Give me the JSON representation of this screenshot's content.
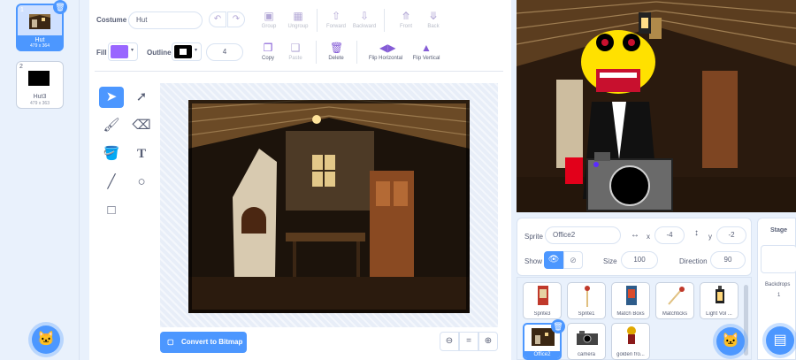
{
  "costumes": [
    {
      "number": "1",
      "name": "Hut",
      "size": "479 x 364",
      "selected": true
    },
    {
      "number": "2",
      "name": "Hut3",
      "size": "479 x 363",
      "selected": false
    }
  ],
  "editor": {
    "costume_label": "Costume",
    "costume_name": "Hut",
    "fill_label": "Fill",
    "fill_color": "#9966ff",
    "outline_label": "Outline",
    "outline_color": "#000000",
    "outline_width": "4",
    "group_label": "Group",
    "ungroup_label": "Ungroup",
    "forward_label": "Forward",
    "backward_label": "Backward",
    "front_label": "Front",
    "back_label": "Back",
    "copy_label": "Copy",
    "paste_label": "Paste",
    "delete_label": "Delete",
    "flip_h_label": "Flip Horizontal",
    "flip_v_label": "Flip Vertical",
    "convert_label": "Convert to Bitmap",
    "zoom_reset_label": "="
  },
  "sprite": {
    "sprite_label": "Sprite",
    "name": "Office2",
    "x_label": "x",
    "x": "-4",
    "y_label": "y",
    "y": "-2",
    "show_label": "Show",
    "size_label": "Size",
    "size": "100",
    "direction_label": "Direction",
    "direction": "90"
  },
  "sprites": [
    {
      "name": "Sprite3",
      "icon": "match-box-icon"
    },
    {
      "name": "Sprite1",
      "icon": "match-stick-icon"
    },
    {
      "name": "Match Boxs",
      "icon": "match-box-icon"
    },
    {
      "name": "Matchticks",
      "icon": "match-stick-icon"
    },
    {
      "name": "Light Vol ...",
      "icon": "lantern-icon"
    },
    {
      "name": "Office2",
      "icon": "office-thumb-icon",
      "selected": true
    },
    {
      "name": "camera",
      "icon": "camera-icon"
    },
    {
      "name": "golden fro...",
      "icon": "frog-icon"
    }
  ],
  "stage_panel": {
    "title": "Stage",
    "backdrops_label": "Backdrops",
    "backdrops_count": "1"
  },
  "colors": {
    "accent": "#4c97ff",
    "paint_purple": "#855cd6"
  }
}
